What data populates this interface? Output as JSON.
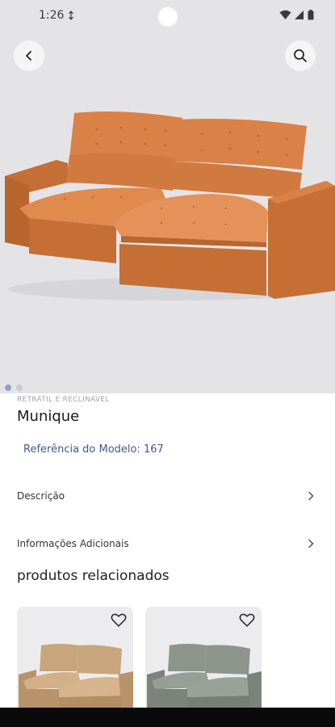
{
  "status_bar": {
    "time": "1:26",
    "icons": [
      "data-sync-icon",
      "wifi-icon",
      "signal-icon",
      "battery-icon"
    ]
  },
  "header": {
    "back_icon": "chevron-left-icon",
    "search_icon": "search-icon"
  },
  "hero": {
    "image": "orange-retractable-sofa",
    "slide_count": 2,
    "active_slide": 1
  },
  "product": {
    "category": "RETRÁTIL E RECLINÁVEL",
    "name": "Munique",
    "reference": "Referência do Modelo: 167"
  },
  "sections": [
    {
      "label": "Descrição",
      "icon": "chevron-right-icon"
    },
    {
      "label": "Informações Adicionais",
      "icon": "chevron-right-icon"
    }
  ],
  "related": {
    "title": "produtos relacionados",
    "items": [
      {
        "image": "beige-sofa",
        "icon": "heart-icon"
      },
      {
        "image": "gray-sofa",
        "icon": "heart-icon"
      }
    ]
  },
  "colors": {
    "sofa_orange": "#d07a40",
    "link_blue": "#3f5b8c",
    "related_beige": "#c9a57c",
    "related_gray": "#8c948c"
  }
}
